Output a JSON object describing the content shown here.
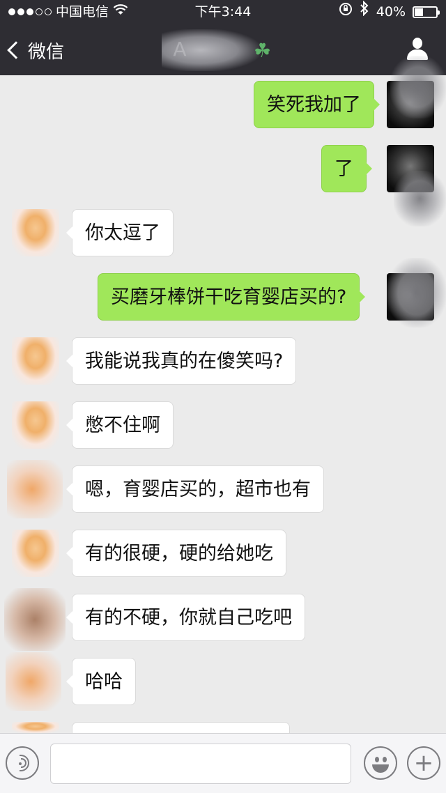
{
  "status_bar": {
    "carrier": "中国电信",
    "time": "下午3:44",
    "battery": "40%",
    "battery_level": 0.4
  },
  "nav": {
    "back_label": "微信",
    "title": "A",
    "title_suffix_icon": "clover-icon",
    "profile_icon": "person-icon"
  },
  "messages": [
    {
      "side": "sent",
      "text": "笑死我加了"
    },
    {
      "side": "sent",
      "text": "了"
    },
    {
      "side": "recv",
      "text": "你太逗了"
    },
    {
      "side": "sent",
      "text": "买磨牙棒饼干吃育婴店买的?"
    },
    {
      "side": "recv",
      "text": "我能说我真的在傻笑吗?"
    },
    {
      "side": "recv",
      "text": "憋不住啊"
    },
    {
      "side": "recv",
      "text": "嗯，育婴店买的，超市也有"
    },
    {
      "side": "recv",
      "text": "有的很硬，硬的给她吃"
    },
    {
      "side": "recv",
      "text": "有的不硬，你就自己吃吧"
    },
    {
      "side": "recv",
      "text": "哈哈"
    }
  ],
  "input_bar": {
    "voice_icon": "voice-icon",
    "text_value": "",
    "emoji_icon": "emoji-icon",
    "plus_icon": "plus-icon"
  },
  "colors": {
    "header_bg": "#2e2d33",
    "chat_bg": "#ebebeb",
    "sent_bubble": "#a0e75a",
    "recv_bubble": "#ffffff"
  }
}
